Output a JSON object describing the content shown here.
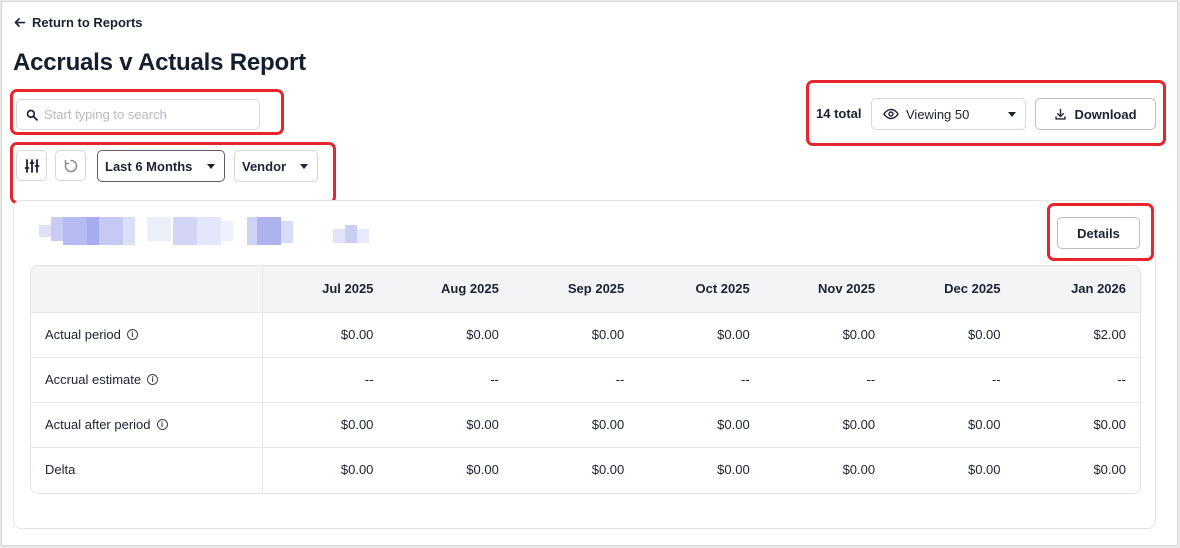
{
  "nav": {
    "back_label": "Return to Reports"
  },
  "page": {
    "title": "Accruals v Actuals Report"
  },
  "search": {
    "placeholder": "Start typing to search",
    "value": ""
  },
  "filters": {
    "date_range": "Last 6 Months",
    "group_by": "Vendor",
    "icons": [
      "filter-sliders-icon",
      "reset-icon"
    ]
  },
  "toolbar": {
    "total_label": "14 total",
    "viewing_label": "Viewing 50",
    "download_label": "Download"
  },
  "card": {
    "details_label": "Details"
  },
  "table": {
    "columns": [
      "",
      "Jul 2025",
      "Aug 2025",
      "Sep 2025",
      "Oct 2025",
      "Nov 2025",
      "Dec 2025",
      "Jan 2026"
    ],
    "rows": [
      {
        "label": "Actual period",
        "info": true,
        "values": [
          "$0.00",
          "$0.00",
          "$0.00",
          "$0.00",
          "$0.00",
          "$0.00",
          "$2.00"
        ]
      },
      {
        "label": "Accrual estimate",
        "info": true,
        "values": [
          "--",
          "--",
          "--",
          "--",
          "--",
          "--",
          "--"
        ]
      },
      {
        "label": "Actual after period",
        "info": true,
        "values": [
          "$0.00",
          "$0.00",
          "$0.00",
          "$0.00",
          "$0.00",
          "$0.00",
          "$0.00"
        ]
      },
      {
        "label": "Delta",
        "info": false,
        "values": [
          "$0.00",
          "$0.00",
          "$0.00",
          "$0.00",
          "$0.00",
          "$0.00",
          "$0.00"
        ]
      }
    ]
  },
  "colors": {
    "highlight": "#e5262e",
    "header_bg": "#f3f4f6",
    "text": "#1c2233"
  }
}
